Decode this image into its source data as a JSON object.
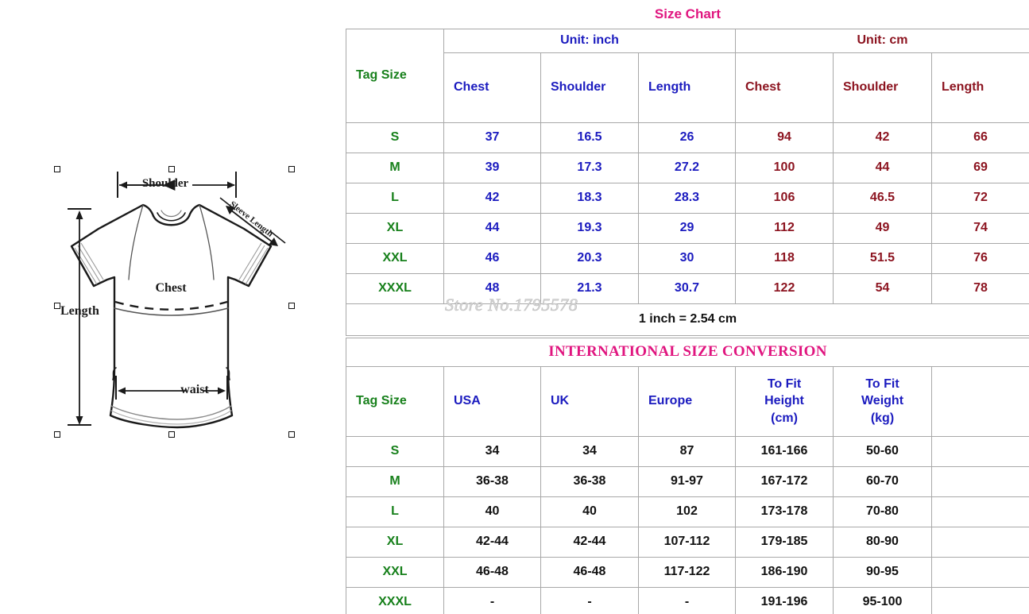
{
  "diagram": {
    "labels": {
      "shoulder": "Shoulder",
      "sleeve_length": "Sleeve Length",
      "chest": "Chest",
      "length": "Length",
      "waist": "waist"
    }
  },
  "size_chart": {
    "title": "Size Chart",
    "unit_inch": "Unit: inch",
    "unit_cm": "Unit: cm",
    "tag_size_header": "Tag Size",
    "columns_inch": [
      "Chest",
      "Shoulder",
      "Length"
    ],
    "columns_cm": [
      "Chest",
      "Shoulder",
      "Length"
    ],
    "note": "1 inch = 2.54 cm",
    "watermark": "Store No.1795578",
    "colors": {
      "title": "#e0157f",
      "tag_size": "#17801b",
      "inch": "#1b1bbf",
      "cm": "#8c1420"
    },
    "rows": [
      {
        "tag": "S",
        "chest_in": "37",
        "shoulder_in": "16.5",
        "length_in": "26",
        "chest_cm": "94",
        "shoulder_cm": "42",
        "length_cm": "66"
      },
      {
        "tag": "M",
        "chest_in": "39",
        "shoulder_in": "17.3",
        "length_in": "27.2",
        "chest_cm": "100",
        "shoulder_cm": "44",
        "length_cm": "69"
      },
      {
        "tag": "L",
        "chest_in": "42",
        "shoulder_in": "18.3",
        "length_in": "28.3",
        "chest_cm": "106",
        "shoulder_cm": "46.5",
        "length_cm": "72"
      },
      {
        "tag": "XL",
        "chest_in": "44",
        "shoulder_in": "19.3",
        "length_in": "29",
        "chest_cm": "112",
        "shoulder_cm": "49",
        "length_cm": "74"
      },
      {
        "tag": "XXL",
        "chest_in": "46",
        "shoulder_in": "20.3",
        "length_in": "30",
        "chest_cm": "118",
        "shoulder_cm": "51.5",
        "length_cm": "76"
      },
      {
        "tag": "XXXL",
        "chest_in": "48",
        "shoulder_in": "21.3",
        "length_in": "30.7",
        "chest_cm": "122",
        "shoulder_cm": "54",
        "length_cm": "78"
      }
    ]
  },
  "conversion_chart": {
    "title": "INTERNATIONAL SIZE CONVERSION",
    "tag_size_header": "Tag Size",
    "columns": [
      "USA",
      "UK",
      "Europe",
      "To Fit Height (cm)",
      "To Fit Weight (kg)"
    ],
    "column_lines": {
      "usa": "USA",
      "uk": "UK",
      "europe": "Europe",
      "height_l1": "To Fit",
      "height_l2": "Height",
      "height_l3": "(cm)",
      "weight_l1": "To Fit",
      "weight_l2": "Weight",
      "weight_l3": "(kg)"
    },
    "rows": [
      {
        "tag": "S",
        "usa": "34",
        "uk": "34",
        "europe": "87",
        "height": "161-166",
        "weight": "50-60",
        "extra": ""
      },
      {
        "tag": "M",
        "usa": "36-38",
        "uk": "36-38",
        "europe": "91-97",
        "height": "167-172",
        "weight": "60-70",
        "extra": ""
      },
      {
        "tag": "L",
        "usa": "40",
        "uk": "40",
        "europe": "102",
        "height": "173-178",
        "weight": "70-80",
        "extra": ""
      },
      {
        "tag": "XL",
        "usa": "42-44",
        "uk": "42-44",
        "europe": "107-112",
        "height": "179-185",
        "weight": "80-90",
        "extra": ""
      },
      {
        "tag": "XXL",
        "usa": "46-48",
        "uk": "46-48",
        "europe": "117-122",
        "height": "186-190",
        "weight": "90-95",
        "extra": ""
      },
      {
        "tag": "XXXL",
        "usa": "-",
        "uk": "-",
        "europe": "-",
        "height": "191-196",
        "weight": "95-100",
        "extra": ""
      }
    ]
  }
}
